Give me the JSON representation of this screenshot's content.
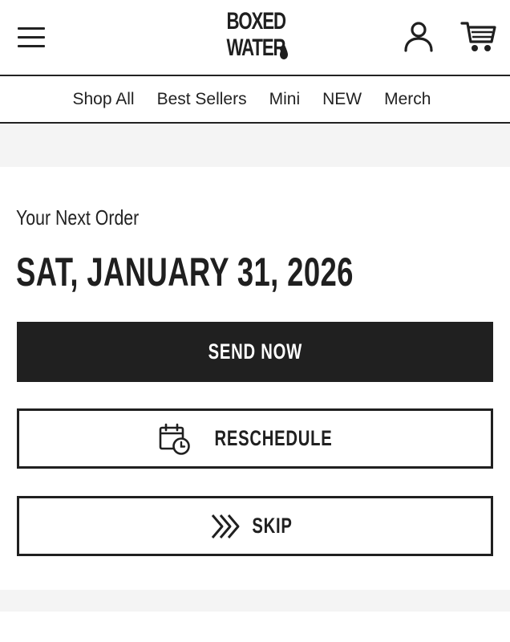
{
  "header": {
    "logo_line1": "BOXED",
    "logo_line2": "WATER",
    "menu_icon": "hamburger-menu-icon",
    "account_icon": "user-account-icon",
    "cart_icon": "shopping-cart-icon"
  },
  "nav": {
    "items": [
      {
        "label": "Shop All"
      },
      {
        "label": "Best Sellers"
      },
      {
        "label": "Mini"
      },
      {
        "label": "NEW"
      },
      {
        "label": "Merch"
      }
    ]
  },
  "order": {
    "label": "Your Next Order",
    "date": "SAT, JANUARY 31, 2026"
  },
  "actions": {
    "send_now": "SEND NOW",
    "reschedule": "RESCHEDULE",
    "reschedule_icon": "calendar-clock-icon",
    "skip": "SKIP",
    "skip_icon": "triple-chevron-right-icon"
  },
  "colors": {
    "primary": "#202020",
    "background": "#ffffff",
    "band": "#f4f4f4"
  }
}
